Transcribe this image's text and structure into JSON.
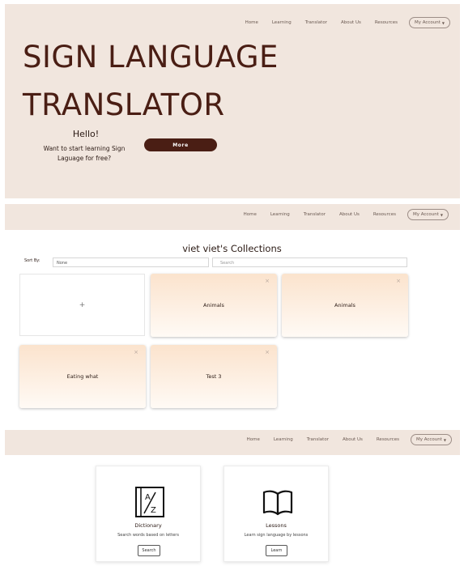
{
  "nav": {
    "links": [
      "Home",
      "Learning",
      "Translator",
      "About Us",
      "Resources"
    ],
    "account": "My Account"
  },
  "hero": {
    "title_line1": "SIGN LANGUAGE",
    "title_line2": "TRANSLATOR",
    "hello": "Hello!",
    "subtitle": "Want to start learning Sign Laguage for free?",
    "more_button": "More"
  },
  "collections": {
    "title": "viet viet's Collections",
    "sort_label": "Sort By:",
    "sort_value": "None",
    "search_placeholder": "Search",
    "add_symbol": "+",
    "close_symbol": "×",
    "cards": [
      "Animals",
      "Animals",
      "Eating what",
      "Test 3"
    ]
  },
  "features": [
    {
      "title": "Dictionary",
      "description": "Search words based on letters",
      "button": "Search",
      "icon": "dictionary-a-z-icon"
    },
    {
      "title": "Lessons",
      "description": "Learn sign language by lessons",
      "button": "Learn",
      "icon": "open-book-icon"
    }
  ],
  "colors": {
    "header_bg": "#f1e6de",
    "accent": "#4a1e14",
    "card_gradient_top": "#fbe3cd"
  }
}
